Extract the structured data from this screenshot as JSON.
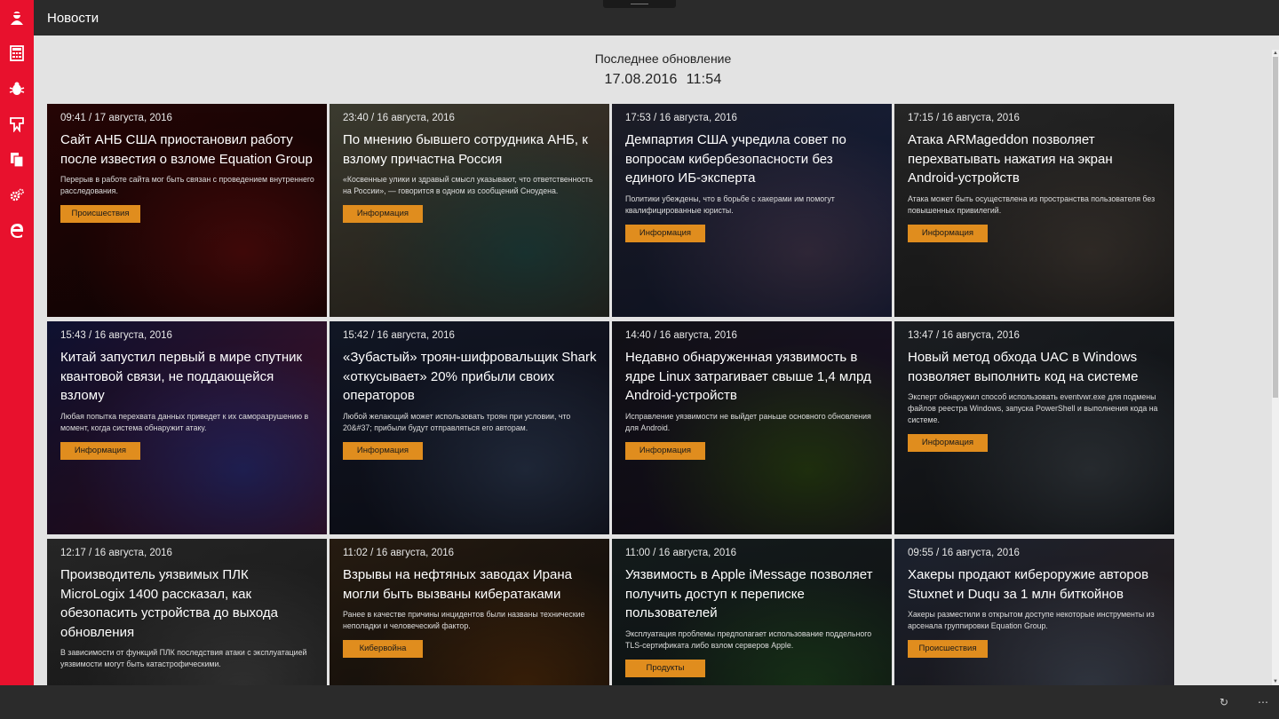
{
  "app": {
    "title": "Новости"
  },
  "sidebar": {
    "items": [
      {
        "icon": "app-logo-icon"
      },
      {
        "icon": "calculator-icon"
      },
      {
        "icon": "bug-icon"
      },
      {
        "icon": "network-icon"
      },
      {
        "icon": "documents-icon"
      },
      {
        "icon": "settings-icon"
      },
      {
        "icon": "edge-browser-icon"
      }
    ]
  },
  "update": {
    "label": "Последнее обновление",
    "date": "17.08.2016",
    "time": "11:54"
  },
  "colors": {
    "accent": "#e8112d",
    "tag": "#e08d1e",
    "background": "#e3e3e3",
    "chrome": "#2b2b2b"
  },
  "cards": [
    {
      "time": "09:41 / 17 августа, 2016",
      "headline": "Сайт АНБ США приостановил работу после известия о взломе Equation Group",
      "lead": "Перерыв в работе сайта мог быть связан с проведением внутреннего расследования.",
      "tag": "Происшествия",
      "colors": [
        "#3a0808",
        "#7a1010",
        "#1a0505"
      ]
    },
    {
      "time": "23:40 / 16 августа, 2016",
      "headline": "По мнению бывшего сотрудника АНБ, к взлому причастна Россия",
      "lead": "«Косвенные улики и здравый смысл указывают, что ответственность на России», — говорится в одном из сообщений Сноудена.",
      "tag": "Информация",
      "colors": [
        "#5a5a48",
        "#2f5f5a",
        "#4a3a30"
      ]
    },
    {
      "time": "17:53 / 16 августа, 2016",
      "headline": "Демпартия США учредила совет по вопросам кибербезопасности без единого ИБ-эксперта",
      "lead": "Политики убеждены, что в борьбе с хакерами им помогут квалифицированные юристы.",
      "tag": "Информация",
      "colors": [
        "#2c2c3a",
        "#5a4a6a",
        "#1a2a5a"
      ]
    },
    {
      "time": "17:15 / 16 августа, 2016",
      "headline": "Атака ARMageddon позволяет перехватывать нажатия на экран Android-устройств",
      "lead": "Атака может быть осуществлена из пространства пользователя без повышенных привилегий.",
      "tag": "Информация",
      "colors": [
        "#3a3a3a",
        "#5a5048",
        "#2a2a2a"
      ]
    },
    {
      "time": "15:43 / 16 августа, 2016",
      "headline": "Китай запустил первый в мире спутник квантовой связи, не поддающейся взлому",
      "lead": "Любая попытка перехвата данных приведет к их саморазрушению в момент, когда система обнаружит атаку.",
      "tag": "Информация",
      "colors": [
        "#151a4a",
        "#3a3a9a",
        "#6a1a3a"
      ]
    },
    {
      "time": "15:42 / 16 августа, 2016",
      "headline": "«Зубастый» троян-шифровальщик Shark «откусывает» 20% прибыли своих операторов",
      "lead": "Любой желающий может использовать троян при условии, что 20&#37; прибыли будут отправляться его авторам.",
      "tag": "Информация",
      "colors": [
        "#1a2238",
        "#3a4a6a",
        "#1a1a2a"
      ]
    },
    {
      "time": "14:40 / 16 августа, 2016",
      "headline": "Недавно обнаруженная уязвимость в ядре Linux затрагивает свыше 1,4 млрд Android-устройств",
      "lead": "Исправление уязвимости не выйдет раньше основного обновления для Android.",
      "tag": "Информация",
      "colors": [
        "#1a1a22",
        "#3a5a1a",
        "#2a1a3a"
      ]
    },
    {
      "time": "13:47 / 16 августа, 2016",
      "headline": "Новый метод обхода UAC в Windows позволяет выполнить код на системе",
      "lead": "Эксперт обнаружил способ использовать eventvwr.exe для подмены файлов реестра Windows, запуска PowerShell и выполнения кода на системе.",
      "tag": "Информация",
      "colors": [
        "#2a2e34",
        "#4a525a",
        "#1a1e24"
      ]
    },
    {
      "time": "12:17 / 16 августа, 2016",
      "headline": "Производитель уязвимых ПЛК MicroLogix 1400 рассказал, как обезопасить устройства до выхода обновления",
      "lead": "В зависимости от функций ПЛК последствия атаки с эксплуатацией уязвимости могут быть катастрофическими.",
      "tag": "",
      "colors": [
        "#3a3a3a",
        "#5a5a5a",
        "#2a2a2a"
      ]
    },
    {
      "time": "11:02 / 16 августа, 2016",
      "headline": "Взрывы на нефтяных заводах Ирана могли быть вызваны кибератаками",
      "lead": "Ранее в качестве причины инцидентов были названы технические неполадки и человеческий фактор.",
      "tag": "Кибервойна",
      "colors": [
        "#3a2a1a",
        "#6a3a10",
        "#1a1410"
      ]
    },
    {
      "time": "11:00 / 16 августа, 2016",
      "headline": "Уязвимость в Apple iMessage позволяет получить доступ к переписке пользователей",
      "lead": "Эксплуатация проблемы предполагает использование поддельного TLS-сертификата либо взлом серверов Apple.",
      "tag": "Продукты",
      "colors": [
        "#1e2a2a",
        "#2a5a2a",
        "#1a1e22"
      ]
    },
    {
      "time": "09:55 / 16 августа, 2016",
      "headline": "Хакеры продают кибероружие авторов Stuxnet и Duqu за 1 млн биткойнов",
      "lead": "Хакеры разместили в открытом доступе некоторые инструменты из арсенала группировки Equation Group.",
      "tag": "Происшествия",
      "colors": [
        "#2a3448",
        "#5a6478",
        "#3a2a2a"
      ]
    }
  ],
  "appbar": {
    "refresh_icon": "refresh-icon",
    "more_icon": "more-icon"
  }
}
